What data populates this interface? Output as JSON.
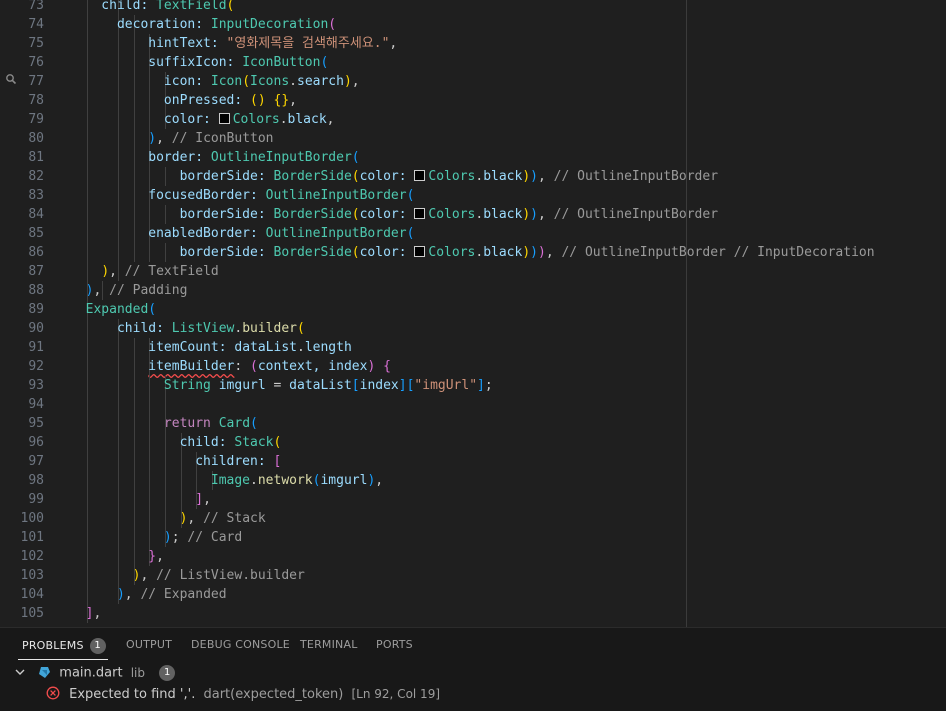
{
  "editor": {
    "lines": [
      {
        "n": "73",
        "guides": [
          2,
          4
        ],
        "code": [
          [
            "    child: ",
            "t-var"
          ],
          [
            "TextField",
            "t-cls"
          ],
          [
            "(",
            "b1"
          ]
        ]
      },
      {
        "n": "74",
        "guides": [
          2,
          4,
          5
        ],
        "code": [
          [
            "      decoration: ",
            "t-var"
          ],
          [
            "InputDecoration",
            "t-cls"
          ],
          [
            "(",
            "b2"
          ]
        ]
      },
      {
        "n": "75",
        "guides": [
          2,
          4,
          5,
          6
        ],
        "code": [
          [
            "          hintText: ",
            "t-var"
          ],
          [
            "\"영화제목을 검색해주세요.\"",
            "t-str"
          ],
          [
            ",",
            "t-p"
          ]
        ]
      },
      {
        "n": "76",
        "guides": [
          2,
          4,
          5,
          6
        ],
        "code": [
          [
            "          suffixIcon: ",
            "t-var"
          ],
          [
            "IconButton",
            "t-cls"
          ],
          [
            "(",
            "b3"
          ]
        ]
      },
      {
        "n": "77",
        "guides": [
          2,
          4,
          5,
          6,
          7
        ],
        "code": [
          [
            "            icon: ",
            "t-var"
          ],
          [
            "Icon",
            "t-cls"
          ],
          [
            "(",
            "b1"
          ],
          [
            "Icons",
            "t-cls"
          ],
          [
            ".",
            "t-p"
          ],
          [
            "search",
            "t-var"
          ],
          [
            ")",
            "b1"
          ],
          [
            ",",
            "t-p"
          ]
        ]
      },
      {
        "n": "78",
        "guides": [
          2,
          4,
          5,
          6,
          7
        ],
        "code": [
          [
            "            onPressed: ",
            "t-var"
          ],
          [
            "()",
            "b1"
          ],
          [
            " ",
            "t-p"
          ],
          [
            "{}",
            "b1"
          ],
          [
            ",",
            "t-p"
          ]
        ]
      },
      {
        "n": "79",
        "guides": [
          2,
          4,
          5,
          6,
          7
        ],
        "code": [
          [
            "            color: ",
            "t-var"
          ],
          [
            "SWATCH",
            "t-p"
          ],
          [
            "Colors",
            "t-cls"
          ],
          [
            ".",
            "t-p"
          ],
          [
            "black",
            "t-var"
          ],
          [
            ",",
            "t-p"
          ]
        ]
      },
      {
        "n": "80",
        "guides": [
          2,
          4,
          5,
          6
        ],
        "code": [
          [
            "          ",
            "t-p"
          ],
          [
            ")",
            "b3"
          ],
          [
            ", ",
            "t-p"
          ],
          [
            "// IconButton",
            "t-cm"
          ]
        ]
      },
      {
        "n": "81",
        "guides": [
          2,
          4,
          5,
          6
        ],
        "code": [
          [
            "          border: ",
            "t-var"
          ],
          [
            "OutlineInputBorder",
            "t-cls"
          ],
          [
            "(",
            "b3"
          ]
        ]
      },
      {
        "n": "82",
        "guides": [
          2,
          4,
          5,
          6,
          7
        ],
        "code": [
          [
            "              borderSide: ",
            "t-var"
          ],
          [
            "BorderSide",
            "t-cls"
          ],
          [
            "(",
            "b1"
          ],
          [
            "color: ",
            "t-var"
          ],
          [
            "SWATCH",
            "t-p"
          ],
          [
            "Colors",
            "t-cls"
          ],
          [
            ".",
            "t-p"
          ],
          [
            "black",
            "t-var"
          ],
          [
            ")",
            "b1"
          ],
          [
            ")",
            "b3"
          ],
          [
            ", ",
            "t-p"
          ],
          [
            "// OutlineInputBorder",
            "t-cm"
          ]
        ]
      },
      {
        "n": "83",
        "guides": [
          2,
          4,
          5,
          6
        ],
        "code": [
          [
            "          focusedBorder: ",
            "t-var"
          ],
          [
            "OutlineInputBorder",
            "t-cls"
          ],
          [
            "(",
            "b3"
          ]
        ]
      },
      {
        "n": "84",
        "guides": [
          2,
          4,
          5,
          6,
          7
        ],
        "code": [
          [
            "              borderSide: ",
            "t-var"
          ],
          [
            "BorderSide",
            "t-cls"
          ],
          [
            "(",
            "b1"
          ],
          [
            "color: ",
            "t-var"
          ],
          [
            "SWATCH",
            "t-p"
          ],
          [
            "Colors",
            "t-cls"
          ],
          [
            ".",
            "t-p"
          ],
          [
            "black",
            "t-var"
          ],
          [
            ")",
            "b1"
          ],
          [
            ")",
            "b3"
          ],
          [
            ", ",
            "t-p"
          ],
          [
            "// OutlineInputBorder",
            "t-cm"
          ]
        ]
      },
      {
        "n": "85",
        "guides": [
          2,
          4,
          5,
          6
        ],
        "code": [
          [
            "          enabledBorder: ",
            "t-var"
          ],
          [
            "OutlineInputBorder",
            "t-cls"
          ],
          [
            "(",
            "b3"
          ]
        ]
      },
      {
        "n": "86",
        "guides": [
          2,
          4,
          5,
          6,
          7
        ],
        "code": [
          [
            "              borderSide: ",
            "t-var"
          ],
          [
            "BorderSide",
            "t-cls"
          ],
          [
            "(",
            "b1"
          ],
          [
            "color: ",
            "t-var"
          ],
          [
            "SWATCH",
            "t-p"
          ],
          [
            "Colors",
            "t-cls"
          ],
          [
            ".",
            "t-p"
          ],
          [
            "black",
            "t-var"
          ],
          [
            ")",
            "b1"
          ],
          [
            ")",
            "b3"
          ],
          [
            ")",
            "b2"
          ],
          [
            ", ",
            "t-p"
          ],
          [
            "// OutlineInputBorder // InputDecoration",
            "t-cm"
          ]
        ]
      },
      {
        "n": "87",
        "guides": [
          2,
          4
        ],
        "code": [
          [
            "    ",
            "t-p"
          ],
          [
            ")",
            "b1"
          ],
          [
            ", ",
            "t-p"
          ],
          [
            "// TextField",
            "t-cm"
          ]
        ]
      },
      {
        "n": "88",
        "guides": [
          2,
          3
        ],
        "code": [
          [
            "  ",
            "t-p"
          ],
          [
            ")",
            "b3"
          ],
          [
            ", ",
            "t-p"
          ],
          [
            "// Padding",
            "t-cm"
          ]
        ]
      },
      {
        "n": "89",
        "guides": [
          2
        ],
        "code": [
          [
            "  ",
            "t-p"
          ],
          [
            "Expanded",
            "t-cls"
          ],
          [
            "(",
            "b3"
          ]
        ]
      },
      {
        "n": "90",
        "guides": [
          2,
          4
        ],
        "code": [
          [
            "      child: ",
            "t-var"
          ],
          [
            "ListView",
            "t-cls"
          ],
          [
            ".",
            "t-p"
          ],
          [
            "builder",
            "t-fn"
          ],
          [
            "(",
            "b1"
          ]
        ]
      },
      {
        "n": "91",
        "guides": [
          2,
          4,
          5,
          6
        ],
        "code": [
          [
            "          itemCount: ",
            "t-var"
          ],
          [
            "dataList",
            "t-var"
          ],
          [
            ".",
            "t-p"
          ],
          [
            "length",
            "t-var"
          ]
        ]
      },
      {
        "n": "92",
        "guides": [
          2,
          4,
          5,
          6
        ],
        "code": [
          [
            "          ",
            "t-p"
          ],
          [
            "itemBuilder",
            "t-var sq"
          ],
          [
            ": ",
            "t-p"
          ],
          [
            "(",
            "b2"
          ],
          [
            "context, index",
            "t-var"
          ],
          [
            ")",
            "b2"
          ],
          [
            " ",
            "t-p"
          ],
          [
            "{",
            "b2"
          ]
        ]
      },
      {
        "n": "93",
        "guides": [
          2,
          4,
          5,
          6,
          7
        ],
        "code": [
          [
            "            String ",
            "t-cls"
          ],
          [
            "imgurl",
            "t-var"
          ],
          [
            " = ",
            "t-p"
          ],
          [
            "dataList",
            "t-var"
          ],
          [
            "[",
            "b3"
          ],
          [
            "index",
            "t-var"
          ],
          [
            "]",
            "b3"
          ],
          [
            "[",
            "b3"
          ],
          [
            "\"imgUrl\"",
            "t-str"
          ],
          [
            "]",
            "b3"
          ],
          [
            ";",
            "t-p"
          ]
        ]
      },
      {
        "n": "94",
        "guides": [
          2,
          4,
          5,
          6,
          7
        ],
        "code": [
          [
            "",
            "t-p"
          ]
        ]
      },
      {
        "n": "95",
        "guides": [
          2,
          4,
          5,
          6,
          7
        ],
        "code": [
          [
            "            ",
            "t-p"
          ],
          [
            "return ",
            "t-kw"
          ],
          [
            "Card",
            "t-cls"
          ],
          [
            "(",
            "b3"
          ]
        ]
      },
      {
        "n": "96",
        "guides": [
          2,
          4,
          5,
          6,
          7,
          8
        ],
        "code": [
          [
            "              child: ",
            "t-var"
          ],
          [
            "Stack",
            "t-cls"
          ],
          [
            "(",
            "b1"
          ]
        ]
      },
      {
        "n": "97",
        "guides": [
          2,
          4,
          5,
          6,
          7,
          8,
          9
        ],
        "code": [
          [
            "                children: ",
            "t-var"
          ],
          [
            "[",
            "b2"
          ]
        ]
      },
      {
        "n": "98",
        "guides": [
          2,
          4,
          5,
          6,
          7,
          8,
          9,
          10
        ],
        "code": [
          [
            "                  Image",
            "t-cls"
          ],
          [
            ".",
            "t-p"
          ],
          [
            "network",
            "t-fn"
          ],
          [
            "(",
            "b3"
          ],
          [
            "imgurl",
            "t-var"
          ],
          [
            ")",
            "b3"
          ],
          [
            ",",
            "t-p"
          ]
        ]
      },
      {
        "n": "99",
        "guides": [
          2,
          4,
          5,
          6,
          7,
          8,
          9
        ],
        "code": [
          [
            "                ",
            "t-p"
          ],
          [
            "]",
            "b2"
          ],
          [
            ",",
            "t-p"
          ]
        ]
      },
      {
        "n": "100",
        "guides": [
          2,
          4,
          5,
          6,
          7,
          8
        ],
        "code": [
          [
            "              ",
            "t-p"
          ],
          [
            ")",
            "b1"
          ],
          [
            ", ",
            "t-p"
          ],
          [
            "// Stack",
            "t-cm"
          ]
        ]
      },
      {
        "n": "101",
        "guides": [
          2,
          4,
          5,
          6,
          7
        ],
        "code": [
          [
            "            ",
            "t-p"
          ],
          [
            ")",
            "b3"
          ],
          [
            "; ",
            "t-p"
          ],
          [
            "// Card",
            "t-cm"
          ]
        ]
      },
      {
        "n": "102",
        "guides": [
          2,
          4,
          5,
          6
        ],
        "code": [
          [
            "          ",
            "t-p"
          ],
          [
            "}",
            "b2"
          ],
          [
            ",",
            "t-p"
          ]
        ]
      },
      {
        "n": "103",
        "guides": [
          2,
          4,
          5
        ],
        "code": [
          [
            "        ",
            "t-p"
          ],
          [
            ")",
            "b1"
          ],
          [
            ", ",
            "t-p"
          ],
          [
            "// ListView.builder",
            "t-cm"
          ]
        ]
      },
      {
        "n": "104",
        "guides": [
          2,
          4
        ],
        "code": [
          [
            "      ",
            "t-p"
          ],
          [
            ")",
            "b3"
          ],
          [
            ", ",
            "t-p"
          ],
          [
            "// Expanded",
            "t-cm"
          ]
        ]
      },
      {
        "n": "105",
        "guides": [
          2
        ],
        "code": [
          [
            "  ",
            "t-p"
          ],
          [
            "]",
            "b2"
          ],
          [
            ",",
            "t-p"
          ]
        ]
      }
    ]
  },
  "panel": {
    "tabs": [
      {
        "label": "PROBLEMS",
        "badge": "1",
        "active": true
      },
      {
        "label": "OUTPUT"
      },
      {
        "label": "DEBUG CONSOLE"
      },
      {
        "label": "TERMINAL"
      },
      {
        "label": "PORTS"
      }
    ],
    "file": {
      "name": "main.dart",
      "folder": "lib",
      "count": "1"
    },
    "problem": {
      "message": "Expected to find ','.",
      "source": "dart(expected_token)",
      "location": "[Ln 92, Col 19]"
    }
  },
  "colors": {
    "background": "#1f1f1f",
    "panel": "#181818",
    "error": "#f14c4c",
    "accent": "#e7e7e7"
  }
}
